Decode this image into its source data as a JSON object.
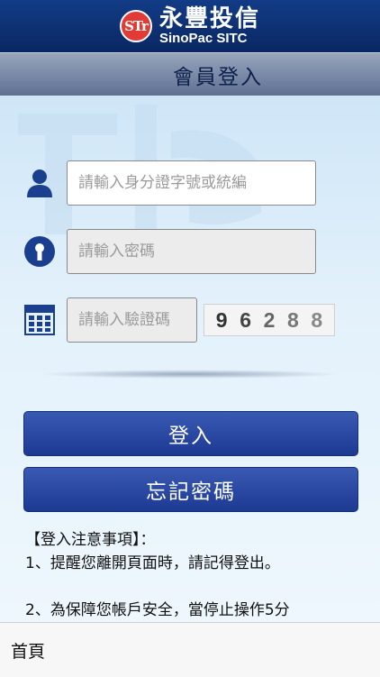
{
  "brand": {
    "logo_text": "STr",
    "name_cn": "永豐投信",
    "name_en": "SinoPac SITC"
  },
  "title": "會員登入",
  "form": {
    "id_placeholder": "請輸入身分證字號或統編",
    "password_placeholder": "請輸入密碼",
    "captcha_placeholder": "請輸入驗證碼",
    "captcha_digits": [
      "9",
      "6",
      "2",
      "8",
      "8"
    ]
  },
  "buttons": {
    "login": "登入",
    "forgot_password": "忘記密碼"
  },
  "notes": {
    "heading": "【登入注意事項】：",
    "item1": "1、提醒您離開頁面時，請記得登出。",
    "item2": "2、為保障您帳戶安全，當停止操作5分"
  },
  "bottom_nav": {
    "home": "首頁"
  },
  "colors": {
    "brand_bar": "#0a2763",
    "button": "#1c3a92",
    "icon": "#1a3f8f",
    "logo_red": "#e23a35"
  },
  "icons": {
    "user": "user-icon",
    "password": "keyhole-icon",
    "captcha": "calculator-icon"
  }
}
